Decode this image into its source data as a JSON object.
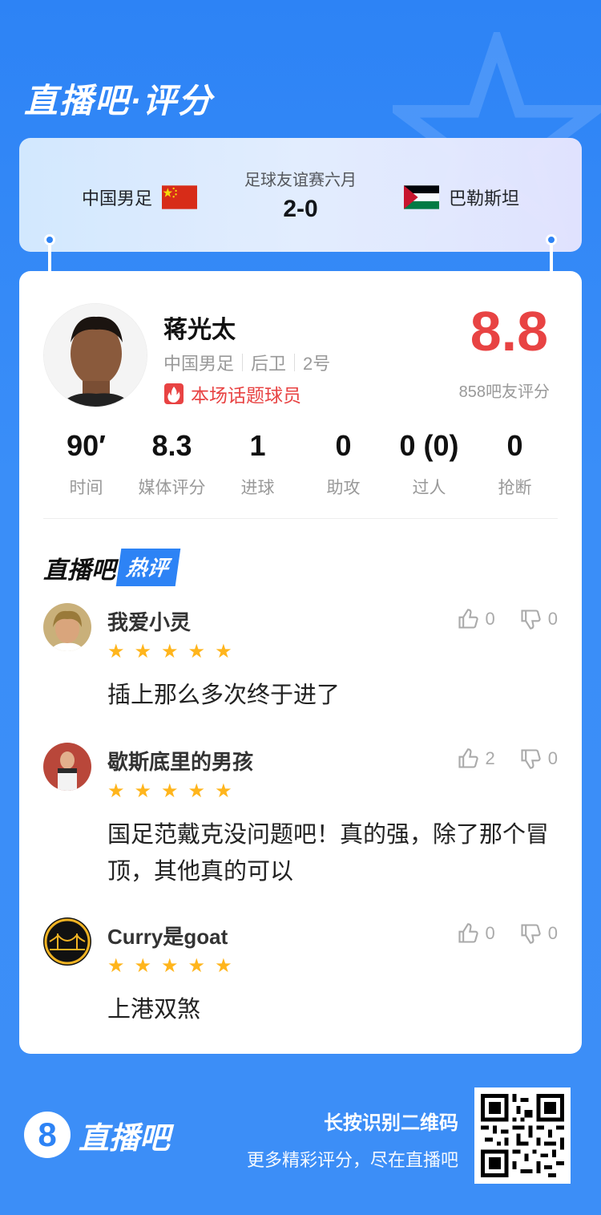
{
  "brand": {
    "title": "直播吧·评分"
  },
  "match": {
    "competition": "足球友谊赛六月",
    "score": "2-0",
    "home_team": "中国男足",
    "away_team": "巴勒斯坦"
  },
  "player": {
    "name": "蒋光太",
    "team": "中国男足",
    "position": "后卫",
    "number": "2号",
    "hot_tag": "本场话题球员",
    "rating": "8.8",
    "rating_count": "858吧友评分"
  },
  "stats": [
    {
      "value": "90′",
      "label": "时间"
    },
    {
      "value": "8.3",
      "label": "媒体评分"
    },
    {
      "value": "1",
      "label": "进球"
    },
    {
      "value": "0",
      "label": "助攻"
    },
    {
      "value": "0 (0)",
      "label": "过人"
    },
    {
      "value": "0",
      "label": "抢断"
    }
  ],
  "hot_section": {
    "title_a": "直播吧",
    "title_b": "热评"
  },
  "comments": [
    {
      "user": "我爱小灵",
      "stars": 5,
      "text": "插上那么多次终于进了",
      "likes": "0",
      "dislikes": "0"
    },
    {
      "user": "歇斯底里的男孩",
      "stars": 5,
      "text": "国足范戴克没问题吧！真的强，除了那个冒顶，其他真的可以",
      "likes": "2",
      "dislikes": "0"
    },
    {
      "user": "Curry是goat",
      "stars": 5,
      "text": "上港双煞",
      "likes": "0",
      "dislikes": "0"
    }
  ],
  "footer": {
    "logo_digit": "8",
    "logo_text": "直播吧",
    "line1": "长按识别二维码",
    "line2": "更多精彩评分，尽在直播吧"
  },
  "colors": {
    "accent": "#2d83f5",
    "rating": "#e84343",
    "star": "#ffb51c"
  }
}
